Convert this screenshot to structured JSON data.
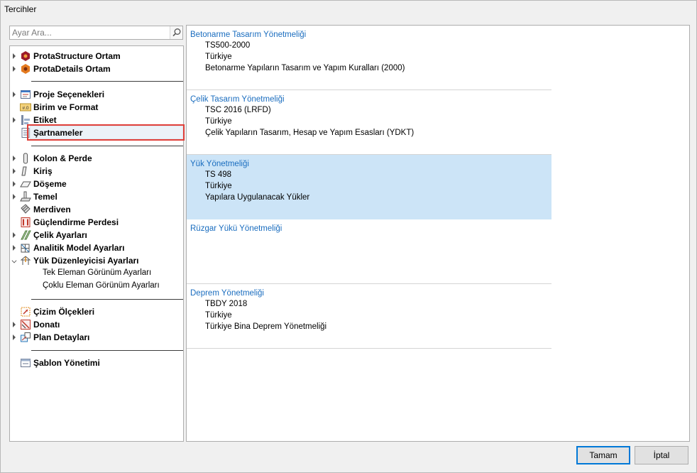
{
  "window": {
    "title": "Tercihler"
  },
  "search": {
    "placeholder": "Ayar Ara..."
  },
  "tree": {
    "items": [
      {
        "label": "ProtaStructure Ortam",
        "icon": "protastructure-icon",
        "arrow": true
      },
      {
        "label": "ProtaDetails Ortam",
        "icon": "protadetails-icon",
        "arrow": true
      },
      {
        "label": "Proje Seçenekleri",
        "icon": "project-options-icon",
        "arrow": true
      },
      {
        "label": "Birim ve Format",
        "icon": "unit-format-icon",
        "arrow": false
      },
      {
        "label": "Etiket",
        "icon": "label-icon",
        "arrow": true
      },
      {
        "label": "Şartnameler",
        "icon": "code-document-icon",
        "arrow": false
      },
      {
        "label": "Kolon & Perde",
        "icon": "column-icon",
        "arrow": true
      },
      {
        "label": "Kiriş",
        "icon": "beam-icon",
        "arrow": true
      },
      {
        "label": "Döşeme",
        "icon": "slab-icon",
        "arrow": true
      },
      {
        "label": "Temel",
        "icon": "foundation-icon",
        "arrow": true
      },
      {
        "label": "Merdiven",
        "icon": "stair-icon",
        "arrow": false
      },
      {
        "label": "Güçlendirme Perdesi",
        "icon": "retrofit-wall-icon",
        "arrow": false
      },
      {
        "label": "Çelik Ayarları",
        "icon": "steel-icon",
        "arrow": true
      },
      {
        "label": "Analitik Model Ayarları",
        "icon": "analytic-model-icon",
        "arrow": true
      },
      {
        "label": "Yük Düzenleyicisi Ayarları",
        "icon": "load-editor-icon",
        "arrow": true
      },
      {
        "label": "Tek Eleman Görünüm Ayarları"
      },
      {
        "label": "Çoklu Eleman Görünüm Ayarları"
      },
      {
        "label": "Çizim Ölçekleri",
        "icon": "drawing-scale-icon",
        "arrow": false
      },
      {
        "label": "Donatı",
        "icon": "reinforcement-icon",
        "arrow": true
      },
      {
        "label": "Plan Detayları",
        "icon": "plan-details-icon",
        "arrow": true
      },
      {
        "label": "Şablon Yönetimi",
        "icon": "template-icon",
        "arrow": false
      }
    ]
  },
  "codes": [
    {
      "title": "Betonarme Tasarım Yönetmeliği",
      "lines": [
        "TS500-2000",
        "Türkiye",
        "Betonarme Yapıların Tasarım ve Yapım Kuralları (2000)"
      ]
    },
    {
      "title": "Çelik Tasarım Yönetmeliği",
      "lines": [
        "TSC 2016 (LRFD)",
        "Türkiye",
        "Çelik Yapıların Tasarım, Hesap ve Yapım Esasları (YDKT)"
      ]
    },
    {
      "title": "Yük Yönetmeliği",
      "lines": [
        "TS 498",
        "Türkiye",
        "Yapılara Uygulanacak Yükler"
      ]
    },
    {
      "title": "Rüzgar Yükü Yönetmeliği",
      "lines": []
    },
    {
      "title": "Deprem Yönetmeliği",
      "lines": [
        "TBDY 2018",
        "Türkiye",
        "Türkiye Bina Deprem Yönetmeliği"
      ]
    }
  ],
  "buttons": {
    "ok": "Tamam",
    "cancel": "İptal"
  },
  "colors": {
    "accent": "#1a6dbf",
    "selected_bg": "#cce4f7",
    "highlight": "#e0403a"
  }
}
